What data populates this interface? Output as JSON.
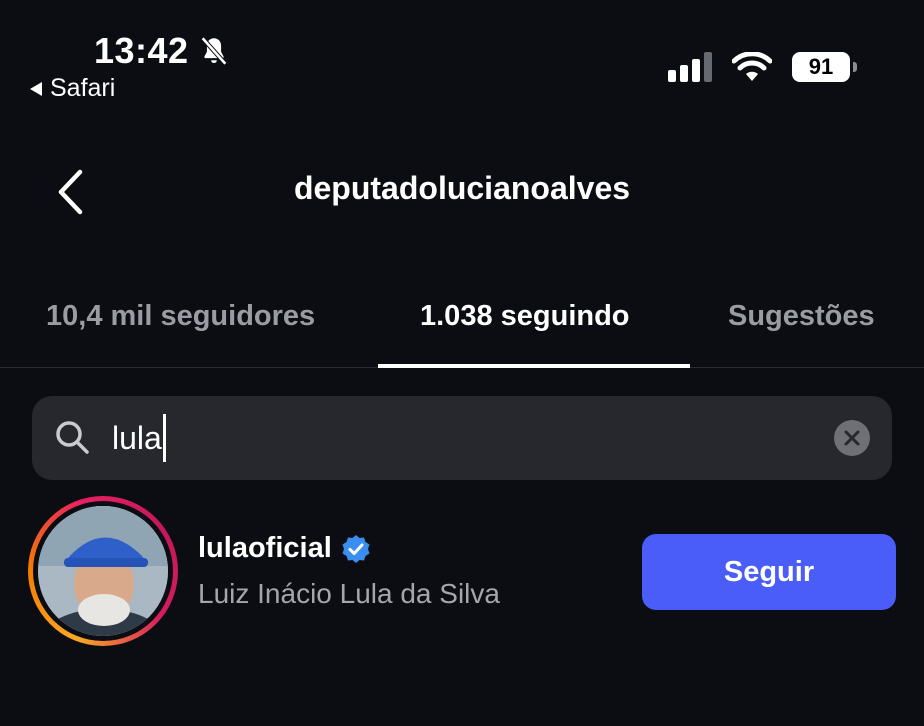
{
  "status_bar": {
    "time": "13:42",
    "back_app": "Safari",
    "battery": "91",
    "icons": [
      "bell-slash-icon",
      "cellular-signal-icon",
      "wifi-icon",
      "battery-icon"
    ]
  },
  "header": {
    "title": "deputadolucianoalves",
    "back_icon": "chevron-left-icon"
  },
  "tabs": [
    {
      "label": "10,4 mil seguidores",
      "active": false
    },
    {
      "label": "1.038 seguindo",
      "active": true
    },
    {
      "label": "Sugestões",
      "active": false
    }
  ],
  "search": {
    "value": "lula",
    "icon": "search-icon",
    "clear_icon": "clear-icon"
  },
  "results": [
    {
      "username": "lulaoficial",
      "verified": true,
      "full_name": "Luiz Inácio Lula da Silva",
      "button_label": "Seguir"
    }
  ],
  "colors": {
    "background": "#0c0d12",
    "search_bg": "#26282e",
    "follow_button": "#4a5df9",
    "verified_badge": "#3a8ef0",
    "muted_text": "#9a9ca3"
  }
}
